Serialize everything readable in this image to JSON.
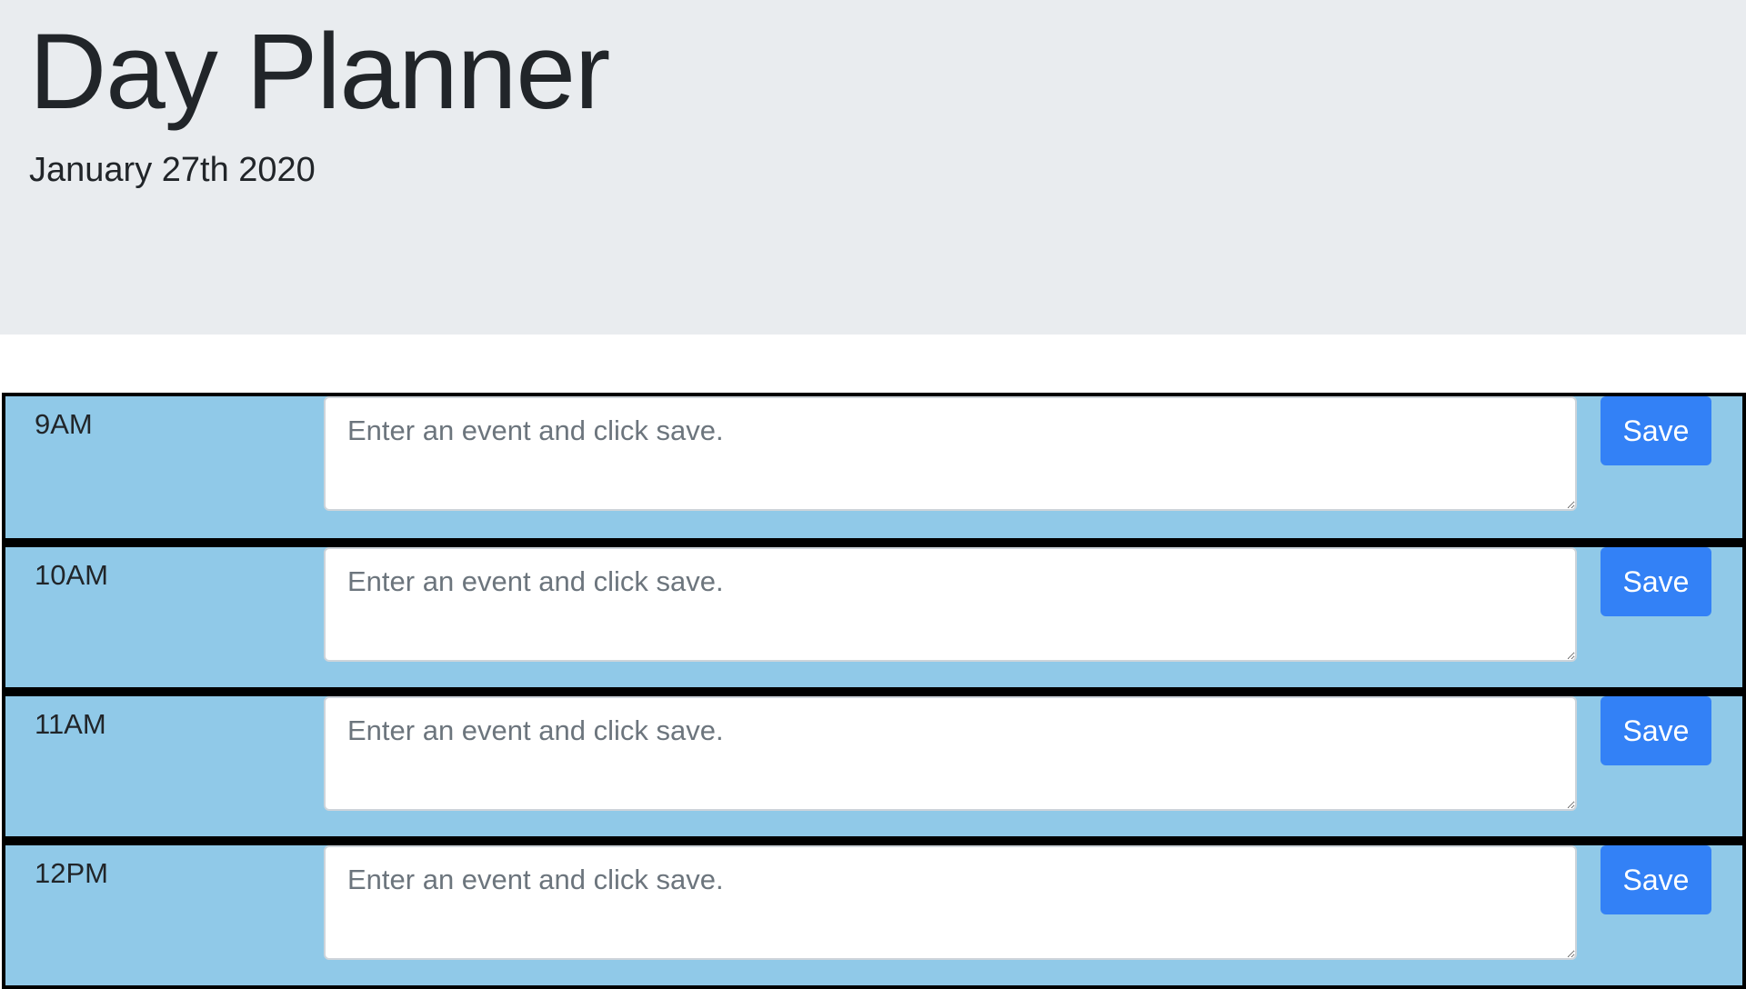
{
  "header": {
    "title": "Day Planner",
    "date": "January 27th 2020"
  },
  "colors": {
    "header_background": "#e9ecef",
    "row_background": "#90c9e8",
    "row_border": "#000000",
    "save_button": "#3381f6"
  },
  "rows": [
    {
      "hour": "9AM",
      "event_value": "",
      "placeholder": "Enter an event and click save.",
      "save_label": "Save"
    },
    {
      "hour": "10AM",
      "event_value": "",
      "placeholder": "Enter an event and click save.",
      "save_label": "Save"
    },
    {
      "hour": "11AM",
      "event_value": "",
      "placeholder": "Enter an event and click save.",
      "save_label": "Save"
    },
    {
      "hour": "12PM",
      "event_value": "",
      "placeholder": "Enter an event and click save.",
      "save_label": "Save"
    }
  ]
}
